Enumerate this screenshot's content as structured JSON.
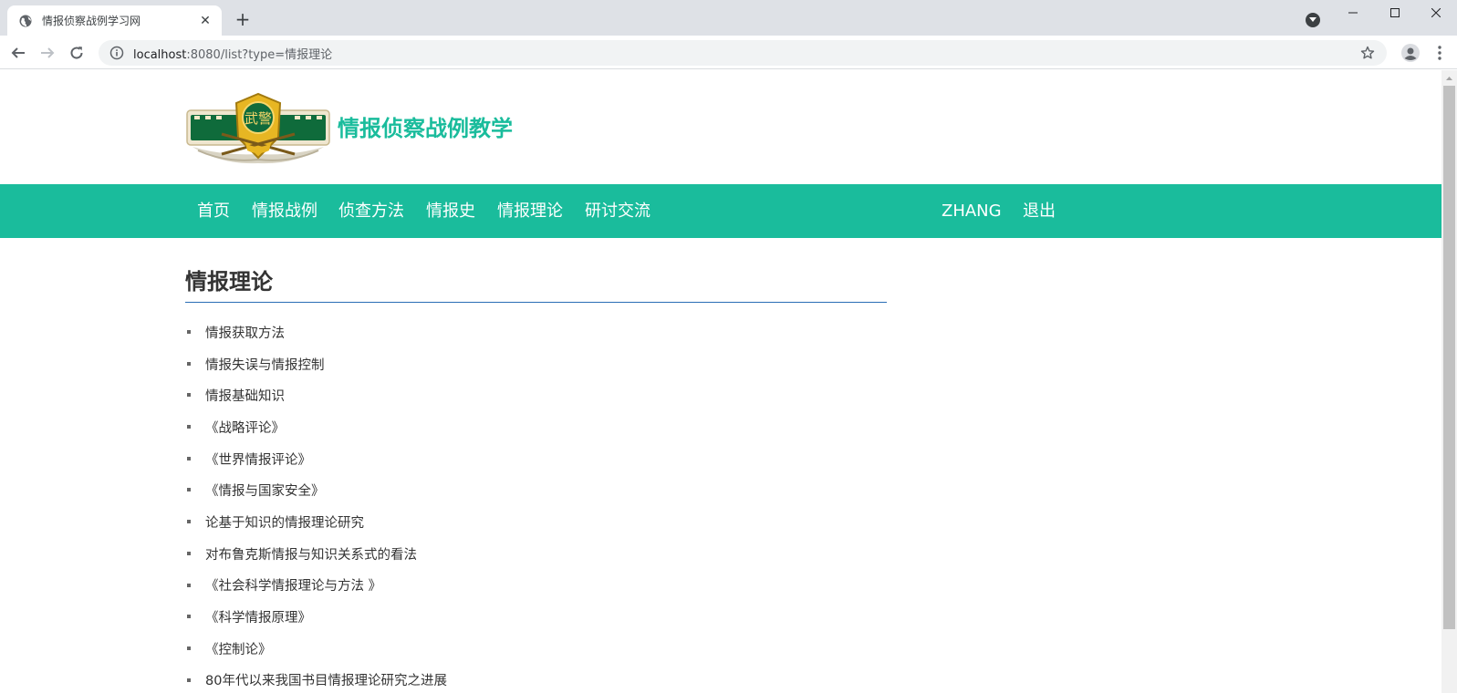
{
  "browser": {
    "tab_title": "情报侦察战例学习网",
    "url_host": "localhost",
    "url_path": ":8080/list?type=情报理论"
  },
  "site": {
    "title": "情报侦察战例教学",
    "logo_text": "武警"
  },
  "nav": {
    "items": [
      "首页",
      "情报战例",
      "侦查方法",
      "情报史",
      "情报理论",
      "研讨交流"
    ],
    "user": "ZHANG",
    "logout": "退出"
  },
  "colors": {
    "accent": "#1abc9c",
    "rule": "#2a6db5"
  },
  "section": {
    "title": "情报理论",
    "items": [
      "情报获取方法",
      "情报失误与情报控制",
      "情报基础知识",
      "《战略评论》",
      "《世界情报评论》",
      "《情报与国家安全》",
      "论基于知识的情报理论研究",
      "对布鲁克斯情报与知识关系式的看法",
      "《社会科学情报理论与方法 》",
      "《科学情报原理》",
      "《控制论》",
      "80年代以来我国书目情报理论研究之进展"
    ]
  }
}
